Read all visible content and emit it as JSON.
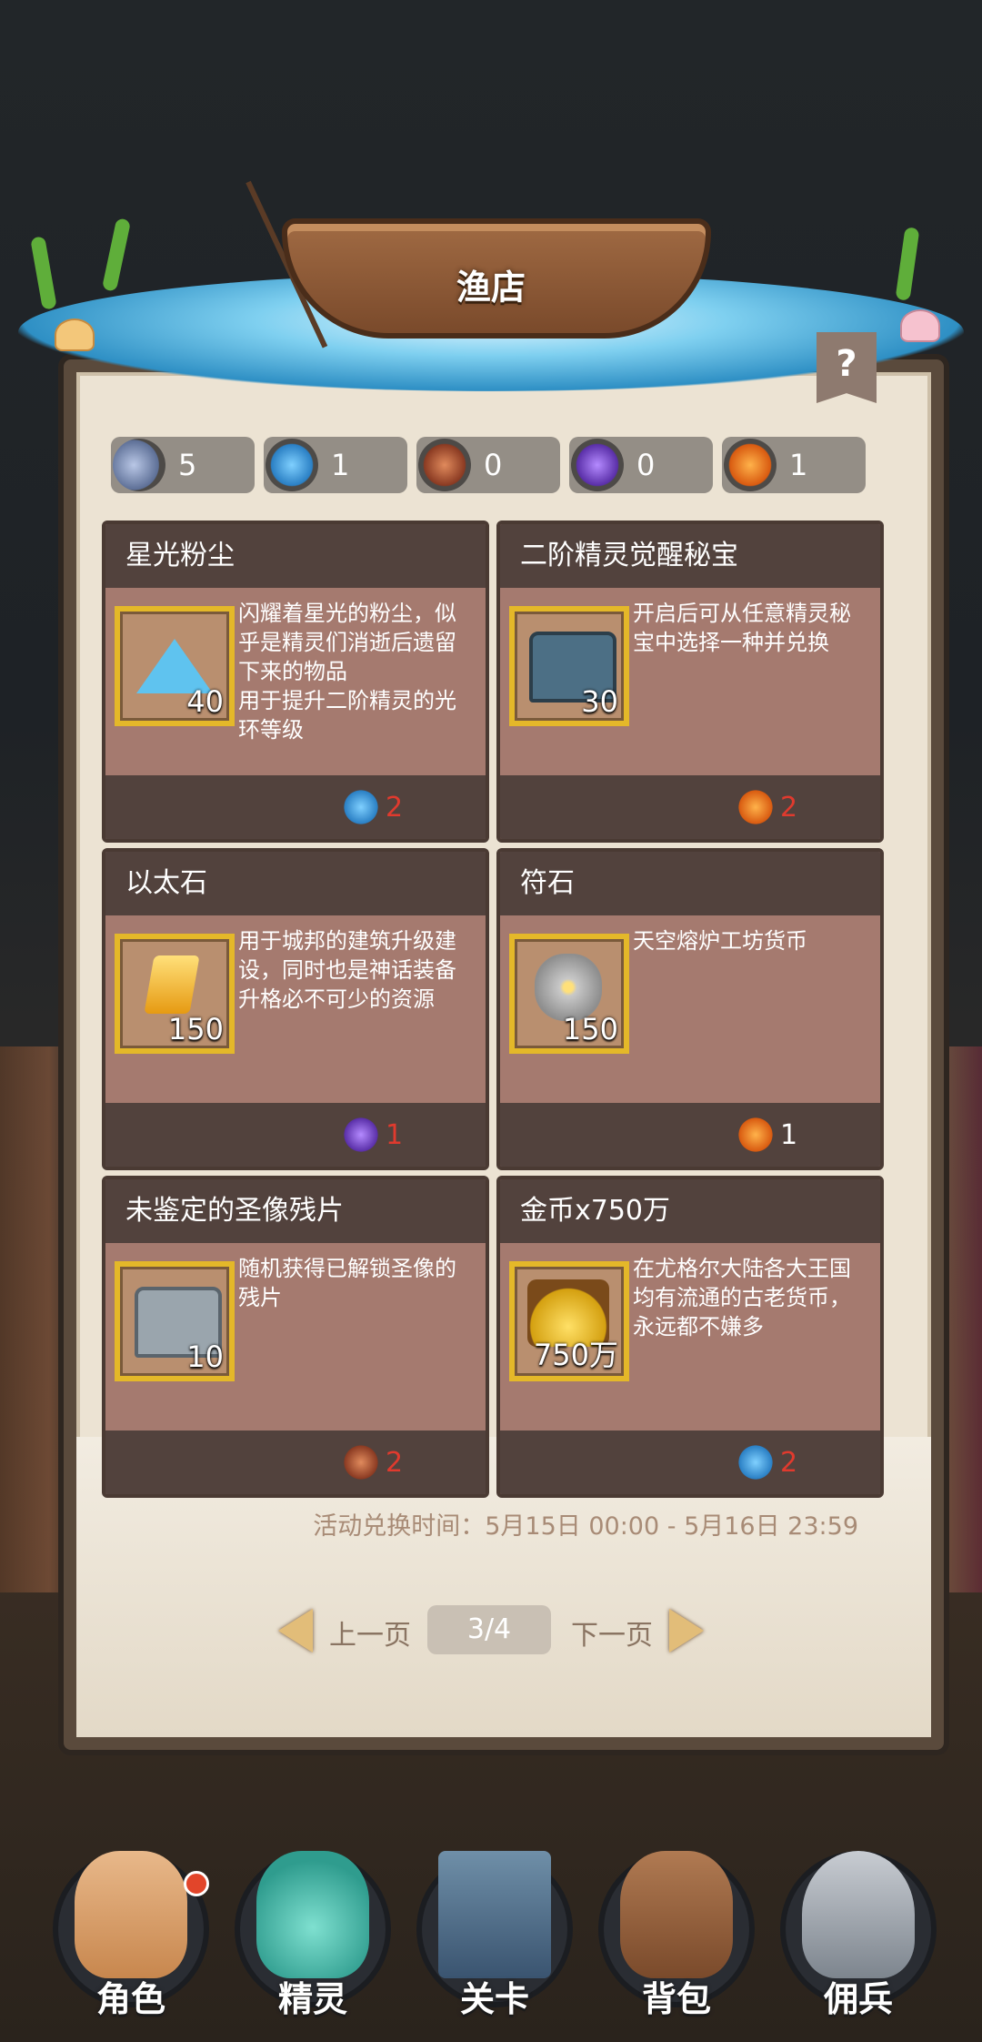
{
  "header": {
    "title": "渔店",
    "help_label": "?"
  },
  "currencies": [
    {
      "icon": "tuna-fish-icon",
      "value": "5",
      "color": "#8fa0c4"
    },
    {
      "icon": "blue-pufferfish-icon",
      "value": "1",
      "color": "#3aa6e8"
    },
    {
      "icon": "red-piranha-icon",
      "value": "0",
      "color": "#c96b3c"
    },
    {
      "icon": "purple-shark-icon",
      "value": "0",
      "color": "#8a4fd6"
    },
    {
      "icon": "goldfish-icon",
      "value": "1",
      "color": "#ef7a1a"
    }
  ],
  "cards": [
    {
      "title": "星光粉尘",
      "item_icon": "stardust-icon",
      "qty": "40",
      "desc": "闪耀着星光的粉尘，似乎是精灵们消逝后遗留下来的物品\n用于提升二阶精灵的光环等级",
      "cost_icon": "blue-pufferfish-icon",
      "cost": "2",
      "affordable": false
    },
    {
      "title": "二阶精灵觉醒秘宝",
      "item_icon": "treasure-chest-icon",
      "qty": "30",
      "desc": "开启后可从任意精灵秘宝中选择一种并兑换",
      "cost_icon": "goldfish-icon",
      "cost": "2",
      "affordable": false
    },
    {
      "title": "以太石",
      "item_icon": "ether-stone-icon",
      "qty": "150",
      "desc": "用于城邦的建筑升级建设，同时也是神话装备升格必不可少的资源",
      "cost_icon": "purple-shark-icon",
      "cost": "1",
      "affordable": false
    },
    {
      "title": "符石",
      "item_icon": "rune-stone-icon",
      "qty": "150",
      "desc": "天空熔炉工坊货币",
      "cost_icon": "goldfish-icon",
      "cost": "1",
      "affordable": true
    },
    {
      "title": "未鉴定的圣像残片",
      "item_icon": "silver-chest-icon",
      "qty": "10",
      "desc": "随机获得已解锁圣像的残片",
      "cost_icon": "red-piranha-icon",
      "cost": "2",
      "affordable": false
    },
    {
      "title": "金币x750万",
      "item_icon": "gold-chest-icon",
      "qty": "750万",
      "desc": "在尤格尔大陆各大王国均有流通的古老货币，永远都不嫌多",
      "cost_icon": "blue-pufferfish-icon",
      "cost": "2",
      "affordable": false
    }
  ],
  "exchange_time": "活动兑换时间：5月15日 00:00 - 5月16日 23:59",
  "pager": {
    "prev": "上一页",
    "next": "下一页",
    "current": "3/4"
  },
  "nav": [
    {
      "label": "角色",
      "icon": "character-icon",
      "badge": true
    },
    {
      "label": "精灵",
      "icon": "spirit-icon",
      "badge": false
    },
    {
      "label": "关卡",
      "icon": "stage-icon",
      "badge": false
    },
    {
      "label": "背包",
      "icon": "backpack-icon",
      "badge": false
    },
    {
      "label": "佣兵",
      "icon": "mercenary-icon",
      "badge": false
    }
  ]
}
